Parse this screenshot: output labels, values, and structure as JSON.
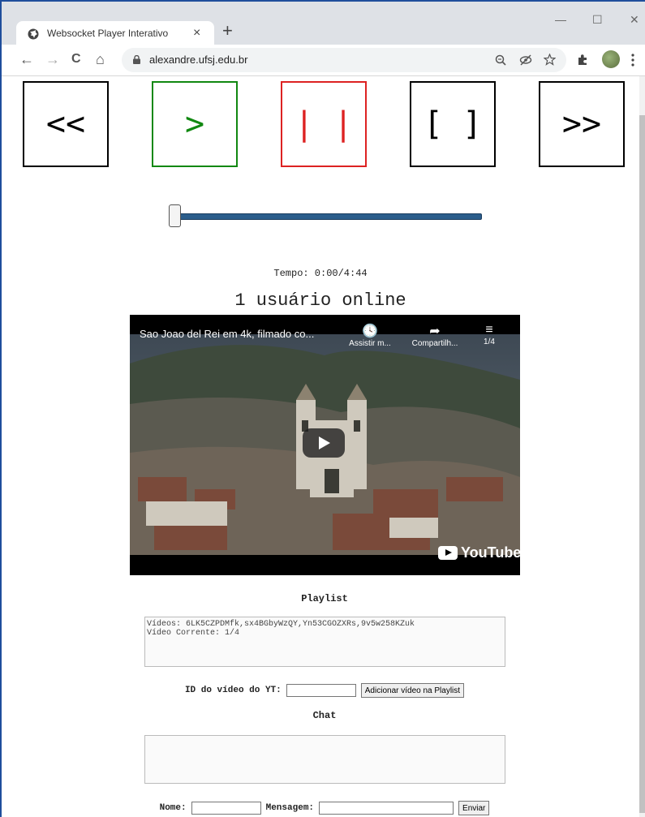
{
  "browser": {
    "tab_title": "Websocket Player Interativo",
    "tab_close": "×",
    "new_tab": "+",
    "url": "alexandre.ufsj.edu.br",
    "window_controls": {
      "minimize": "—",
      "maximize": "☐",
      "close": "✕"
    },
    "nav": {
      "back": "←",
      "forward": "→",
      "reload": "C",
      "home": "⌂"
    },
    "icons": [
      "zoom-icon",
      "eye-off-icon",
      "star-icon",
      "extensions-icon",
      "profile-avatar",
      "menu-icon"
    ]
  },
  "controls": [
    {
      "label": "<<",
      "color": "#000000"
    },
    {
      "label": ">",
      "color": "#118811"
    },
    {
      "label": "| |",
      "color": "#dd2222"
    },
    {
      "label": "[ ]",
      "color": "#000000"
    },
    {
      "label": ">>",
      "color": "#000000"
    }
  ],
  "seek": {
    "position": 0
  },
  "tempo": "Tempo: 0:00/4:44",
  "online": "1 usuário online",
  "video": {
    "title": "Sao Joao del Rei em 4k, filmado co...",
    "watch_later": "Assistir m...",
    "share": "Compartilh...",
    "playlist_pos": "1/4",
    "brand": "YouTube"
  },
  "playlist": {
    "heading": "Playlist",
    "content": "Vídeos: 6LK5CZPDMfk,sx4BGbyWzQY,Yn53CGOZXRs,9v5w258KZuk\nVídeo Corrente: 1/4",
    "id_label": "ID do vídeo do YT:",
    "id_value": "",
    "add_button": "Adicionar vídeo na Playlist"
  },
  "chat": {
    "heading": "Chat",
    "log": "",
    "name_label": "Nome:",
    "name_value": "",
    "message_label": "Mensagem:",
    "message_value": "",
    "send_button": "Enviar"
  }
}
